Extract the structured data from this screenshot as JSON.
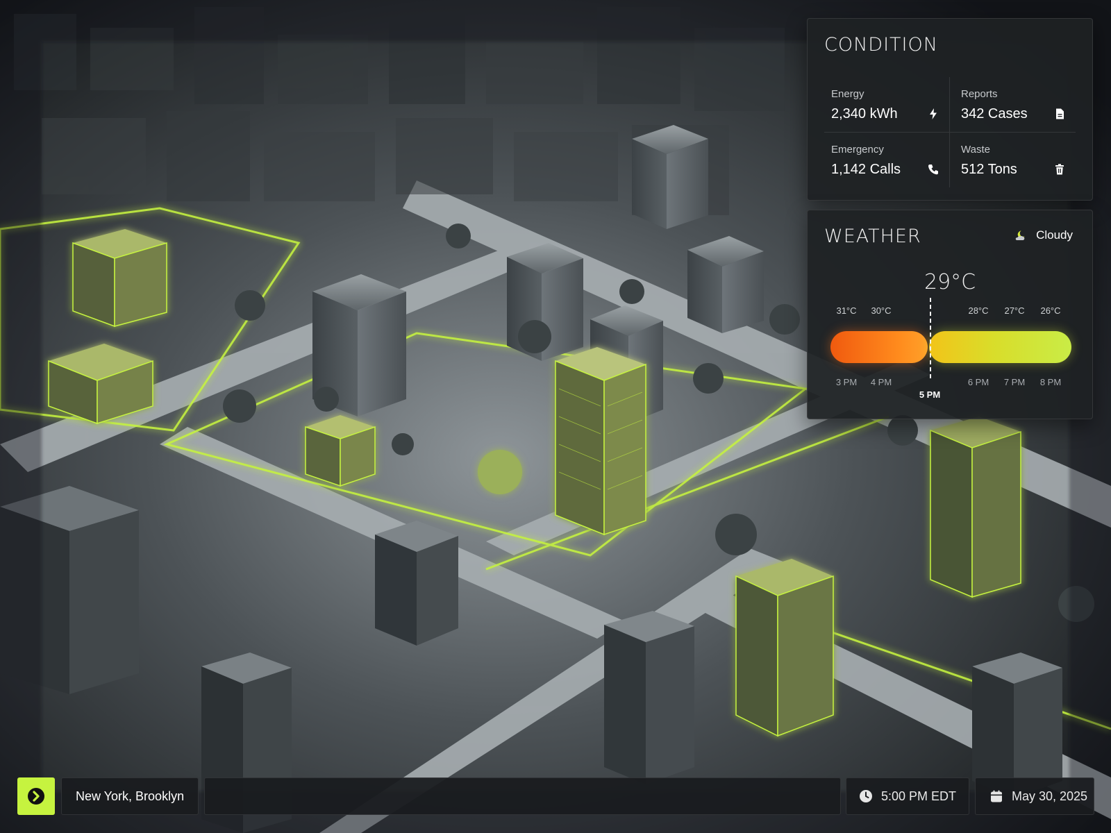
{
  "condition": {
    "title": "CONDITION",
    "metrics": [
      {
        "label": "Energy",
        "value": "2,340 kWh",
        "icon": "bolt-icon"
      },
      {
        "label": "Reports",
        "value": "342 Cases",
        "icon": "document-icon"
      },
      {
        "label": "Emergency",
        "value": "1,142 Calls",
        "icon": "phone-icon"
      },
      {
        "label": "Waste",
        "value": "512 Tons",
        "icon": "trash-icon"
      }
    ]
  },
  "weather": {
    "title": "WEATHER",
    "status": "Cloudy",
    "status_icon": "cloud-moon-icon",
    "current_temp": "29°C",
    "temps": [
      "31°C",
      "30°C",
      "28°C",
      "27°C",
      "26°C"
    ],
    "hours": [
      "3 PM",
      "4 PM",
      "6 PM",
      "7 PM",
      "8 PM"
    ],
    "now_label": "5 PM",
    "colors": {
      "warm": "#f05a0f",
      "mild": "#c9ec46"
    }
  },
  "bottom_bar": {
    "location": "New York, Brooklyn",
    "time": "5:00 PM EDT",
    "date": "May 30, 2025",
    "accent": "#c6f33f"
  }
}
